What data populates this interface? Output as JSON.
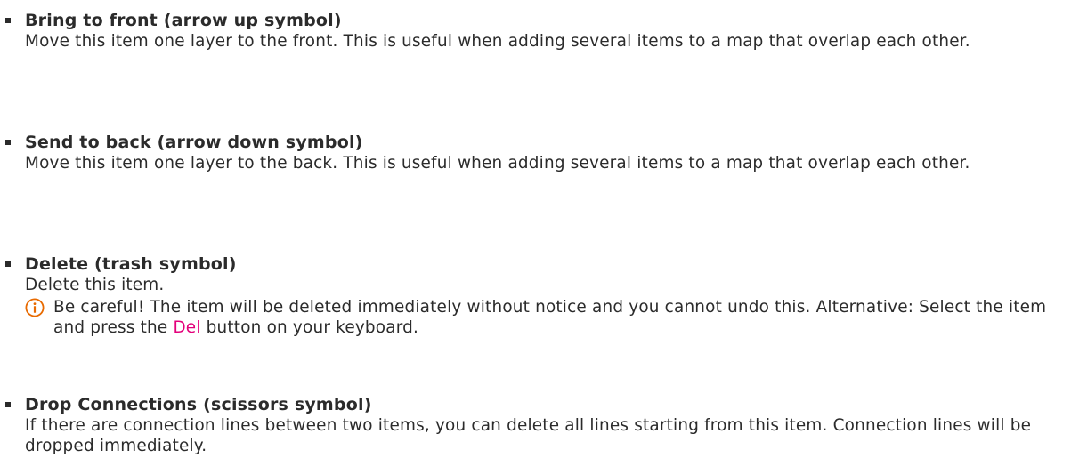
{
  "items": [
    {
      "title": "Bring to front (arrow up symbol)",
      "desc": "Move this item one layer to the front. This is useful when adding several items to a map that overlap each other."
    },
    {
      "title": "Send to back (arrow down symbol)",
      "desc": "Move this item one layer to the back. This is useful when adding several items to a map that overlap each other."
    },
    {
      "title": "Delete (trash symbol)",
      "desc": "Delete this item.",
      "note": {
        "before": "Be careful! The item will be deleted immediately without notice and you cannot undo this. Alternative: Select the item and press the ",
        "key": "Del",
        "after": " button on your keyboard.",
        "icon": "info-icon",
        "icon_color": "#e86a00"
      }
    },
    {
      "title": "Drop Connections (scissors symbol)",
      "desc": "If there are connection lines between two items, you can delete all lines starting from this item. Connection lines will be dropped immediately."
    }
  ],
  "colors": {
    "text": "#2b2b2b",
    "key_highlight": "#e3007b",
    "info_icon": "#e86a00"
  }
}
